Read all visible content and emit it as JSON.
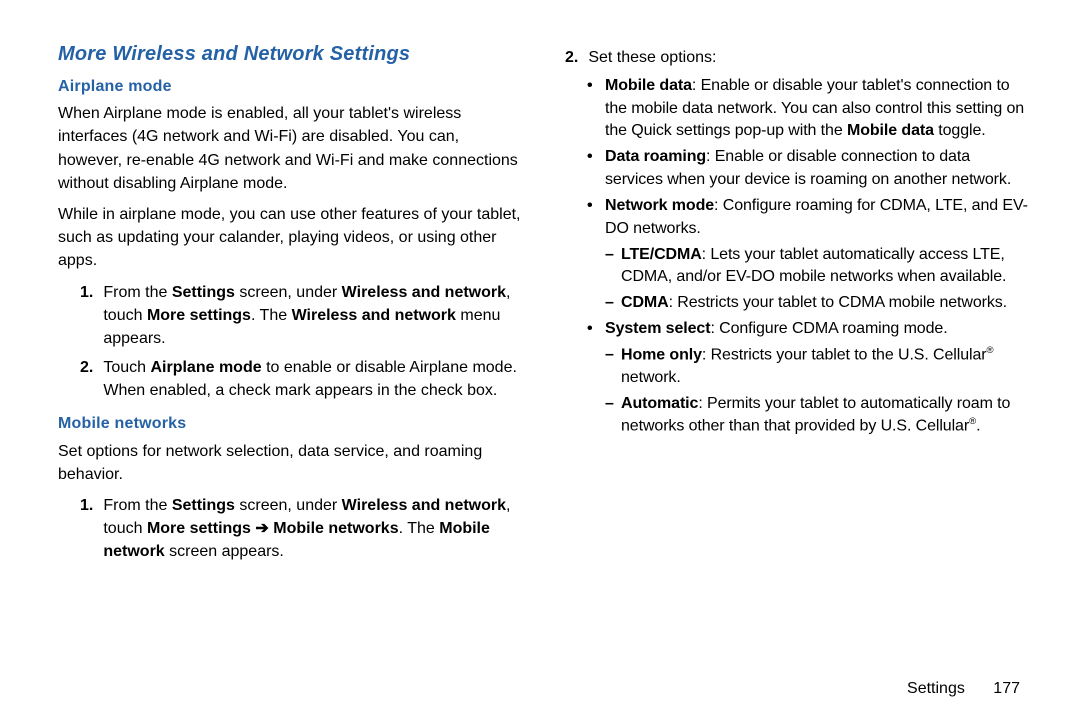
{
  "left": {
    "h1": "More Wireless and Network Settings",
    "h2a": "Airplane mode",
    "p1": "When Airplane mode is enabled, all your tablet's wireless interfaces (4G network and Wi-Fi) are disabled. You can, however, re-enable 4G network and Wi-Fi and make connections without disabling Airplane mode.",
    "p2": "While in airplane mode, you can use other features of your tablet, such as updating your calander, playing videos, or using other apps.",
    "step1_num": "1.",
    "step1_a": "From the ",
    "step1_b": "Settings",
    "step1_c": " screen, under ",
    "step1_d": "Wireless and network",
    "step1_e": ", touch ",
    "step1_f": "More settings",
    "step1_g": ". The ",
    "step1_h": "Wireless and network",
    "step1_i": " menu appears.",
    "step2_num": "2.",
    "step2_a": "Touch ",
    "step2_b": "Airplane mode",
    "step2_c": " to enable or disable Airplane mode. When enabled, a check mark appears in the check box.",
    "h2b": "Mobile networks",
    "p3": "Set options for network selection, data service, and roaming behavior.",
    "mstep1_num": "1.",
    "mstep1_a": "From the ",
    "mstep1_b": "Settings",
    "mstep1_c": " screen, under ",
    "mstep1_d": "Wireless and network",
    "mstep1_e": ", touch ",
    "mstep1_f": "More settings ➔ Mobile networks",
    "mstep1_g": ". The ",
    "mstep1_h": "Mobile network",
    "mstep1_i": " screen appears."
  },
  "right": {
    "step2_num": "2.",
    "step2_text": "Set these options:",
    "b1_a": "Mobile data",
    "b1_b": ": Enable or disable your tablet's connection  to the mobile data network. You can also control this setting on the Quick settings pop-up with the ",
    "b1_c": "Mobile data",
    "b1_d": " toggle.",
    "b2_a": "Data roaming",
    "b2_b": ": Enable or disable connection to data services when your device is roaming on another network.",
    "b3_a": "Network mode",
    "b3_b": ": Configure roaming for CDMA, LTE, and EV-DO networks.",
    "d1_a": "LTE/CDMA",
    "d1_b": ": Lets your tablet automatically access LTE, CDMA, and/or EV-DO mobile networks when available.",
    "d2_a": "CDMA",
    "d2_b": ": Restricts your tablet to CDMA mobile networks.",
    "b4_a": "System select",
    "b4_b": ": Configure CDMA roaming mode.",
    "d3_a": "Home only",
    "d3_b1": ": Restricts your tablet to the U.S. Cellular",
    "d3_b2": " network.",
    "d4_a": "Automatic",
    "d4_b1": ": Permits your tablet to automatically roam to networks other than that provided by U.S. Cellular",
    "d4_b2": "."
  },
  "footer": {
    "section": "Settings",
    "page": "177"
  }
}
